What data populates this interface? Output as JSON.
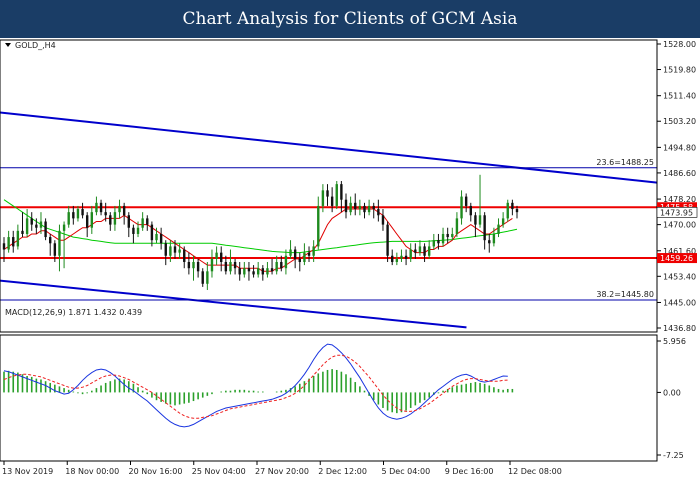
{
  "header": {
    "title": "Chart Analysis for Clients of GCM Asia"
  },
  "colors": {
    "header_bg": "#1a3d66",
    "bull": "#1e8a1e",
    "bear": "#111111",
    "ma_fast": "#e00000",
    "ma_slow": "#00cc00",
    "trend_channel": "#0000cc",
    "sr_line": "#ee0000",
    "fibo_line": "#0000aa",
    "macd_hist": "#2aa02a",
    "macd_line": "#1a35e0",
    "macd_signal": "#ee2020"
  },
  "chart_data": [
    {
      "type": "candlestick",
      "symbol_label": "GOLD_,H4",
      "ylim": [
        1436.8,
        1528.0
      ],
      "y_ticks": [
        "1528.00",
        "1519.80",
        "1511.40",
        "1503.20",
        "1494.80",
        "1486.60",
        "1478.20",
        "1470.00",
        "1461.60",
        "1453.40",
        "1445.00",
        "1436.80"
      ],
      "x_ticks": [
        "13 Nov 2019",
        "18 Nov 00:00",
        "20 Nov 16:00",
        "25 Nov 04:00",
        "27 Nov 20:00",
        "2 Dec 12:00",
        "5 Dec 04:00",
        "9 Dec 16:00",
        "12 Dec 08:00"
      ],
      "levels": [
        {
          "price": 1488.25,
          "label": "23.6=1488.25",
          "kind": "fibo"
        },
        {
          "price": 1475.58,
          "label": "1475.58",
          "kind": "resistance"
        },
        {
          "price": 1459.26,
          "label": "1459.26",
          "kind": "support"
        },
        {
          "price": 1445.8,
          "label": "38.2=1445.80",
          "kind": "fibo"
        }
      ],
      "current_price": {
        "value": 1473.95,
        "label": "1473.95"
      },
      "trend_channel": {
        "upper": {
          "start_price": 1506.0,
          "end_price": 1483.5
        },
        "lower": {
          "start_price": 1452.0,
          "end_price": 1437.0,
          "end_fraction": 0.71
        }
      },
      "candles": [
        [
          1464,
          1462,
          1466,
          1458
        ],
        [
          1462,
          1466,
          1468,
          1461
        ],
        [
          1466,
          1463,
          1468,
          1461
        ],
        [
          1463,
          1468,
          1470,
          1462
        ],
        [
          1468,
          1467,
          1474,
          1466
        ],
        [
          1467,
          1472,
          1475,
          1466
        ],
        [
          1472,
          1470,
          1474,
          1468
        ],
        [
          1470,
          1469,
          1472,
          1467
        ],
        [
          1469,
          1471,
          1474,
          1467
        ],
        [
          1471,
          1466,
          1472,
          1465
        ],
        [
          1466,
          1464,
          1467,
          1460
        ],
        [
          1464,
          1460,
          1465,
          1458
        ],
        [
          1460,
          1468,
          1470,
          1455
        ],
        [
          1468,
          1470,
          1471,
          1456
        ],
        [
          1470,
          1474,
          1476,
          1469
        ],
        [
          1474,
          1472,
          1476,
          1470
        ],
        [
          1472,
          1475,
          1476,
          1471
        ],
        [
          1475,
          1473,
          1477,
          1472
        ],
        [
          1473,
          1469,
          1474,
          1466
        ],
        [
          1469,
          1474,
          1476,
          1467
        ],
        [
          1474,
          1477,
          1479,
          1473
        ],
        [
          1477,
          1474,
          1478,
          1473
        ],
        [
          1474,
          1473,
          1477,
          1471
        ],
        [
          1473,
          1470,
          1474,
          1468
        ],
        [
          1470,
          1474,
          1476,
          1468
        ],
        [
          1474,
          1476,
          1478,
          1472
        ],
        [
          1476,
          1473,
          1477,
          1470
        ],
        [
          1473,
          1469,
          1474,
          1466
        ],
        [
          1469,
          1467,
          1470,
          1464
        ],
        [
          1467,
          1469,
          1471,
          1466
        ],
        [
          1469,
          1472,
          1474,
          1468
        ],
        [
          1472,
          1470,
          1473,
          1468
        ],
        [
          1470,
          1465,
          1471,
          1463
        ],
        [
          1465,
          1467,
          1469,
          1464
        ],
        [
          1467,
          1464,
          1469,
          1462
        ],
        [
          1464,
          1460,
          1465,
          1457
        ],
        [
          1460,
          1463,
          1465,
          1458
        ],
        [
          1463,
          1461,
          1465,
          1459
        ],
        [
          1461,
          1462,
          1464,
          1459
        ],
        [
          1462,
          1458,
          1463,
          1456
        ],
        [
          1458,
          1456,
          1461,
          1454
        ],
        [
          1456,
          1458,
          1460,
          1452
        ],
        [
          1458,
          1455,
          1459,
          1453
        ],
        [
          1455,
          1451,
          1456,
          1450
        ],
        [
          1451,
          1455,
          1458,
          1449
        ],
        [
          1455,
          1459,
          1462,
          1453
        ],
        [
          1459,
          1461,
          1463,
          1457
        ],
        [
          1461,
          1458,
          1463,
          1455
        ],
        [
          1458,
          1455,
          1460,
          1454
        ],
        [
          1455,
          1458,
          1462,
          1454
        ],
        [
          1458,
          1456,
          1459,
          1454
        ],
        [
          1456,
          1454,
          1458,
          1452
        ],
        [
          1454,
          1456,
          1458,
          1453
        ],
        [
          1456,
          1455,
          1458,
          1452
        ],
        [
          1455,
          1454,
          1457,
          1453
        ],
        [
          1454,
          1456,
          1458,
          1453
        ],
        [
          1456,
          1454,
          1457,
          1452
        ],
        [
          1454,
          1456,
          1458,
          1453
        ],
        [
          1456,
          1455,
          1459,
          1454
        ],
        [
          1455,
          1458,
          1460,
          1454
        ],
        [
          1458,
          1456,
          1460,
          1455
        ],
        [
          1456,
          1460,
          1462,
          1454
        ],
        [
          1460,
          1462,
          1465,
          1459
        ],
        [
          1462,
          1459,
          1463,
          1456
        ],
        [
          1459,
          1458,
          1461,
          1455
        ],
        [
          1458,
          1461,
          1464,
          1457
        ],
        [
          1461,
          1460,
          1463,
          1458
        ],
        [
          1460,
          1463,
          1465,
          1458
        ],
        [
          1463,
          1476,
          1479,
          1462
        ],
        [
          1476,
          1481,
          1483,
          1474
        ],
        [
          1481,
          1479,
          1483,
          1476
        ],
        [
          1479,
          1476,
          1482,
          1474
        ],
        [
          1476,
          1483,
          1484,
          1475
        ],
        [
          1483,
          1478,
          1484,
          1474
        ],
        [
          1478,
          1474,
          1480,
          1472
        ],
        [
          1474,
          1477,
          1479,
          1473
        ],
        [
          1477,
          1475,
          1480,
          1473
        ],
        [
          1475,
          1476,
          1478,
          1473
        ],
        [
          1476,
          1474,
          1477,
          1472
        ],
        [
          1474,
          1476,
          1478,
          1473
        ],
        [
          1476,
          1475,
          1477,
          1472
        ],
        [
          1475,
          1473,
          1478,
          1471
        ],
        [
          1473,
          1470,
          1475,
          1468
        ],
        [
          1470,
          1460,
          1471,
          1458
        ],
        [
          1460,
          1458,
          1462,
          1457
        ],
        [
          1458,
          1459,
          1461,
          1457
        ],
        [
          1459,
          1460,
          1462,
          1458
        ],
        [
          1460,
          1459,
          1462,
          1457
        ],
        [
          1459,
          1462,
          1464,
          1458
        ],
        [
          1462,
          1461,
          1464,
          1459
        ],
        [
          1461,
          1463,
          1465,
          1460
        ],
        [
          1463,
          1460,
          1464,
          1458
        ],
        [
          1460,
          1463,
          1465,
          1459
        ],
        [
          1463,
          1465,
          1467,
          1462
        ],
        [
          1465,
          1464,
          1467,
          1462
        ],
        [
          1464,
          1467,
          1469,
          1463
        ],
        [
          1467,
          1466,
          1469,
          1464
        ],
        [
          1466,
          1467,
          1469,
          1465
        ],
        [
          1467,
          1472,
          1474,
          1466
        ],
        [
          1472,
          1479,
          1481,
          1470
        ],
        [
          1479,
          1476,
          1480,
          1474
        ],
        [
          1476,
          1473,
          1477,
          1471
        ],
        [
          1473,
          1470,
          1474,
          1466
        ],
        [
          1470,
          1473,
          1486,
          1469
        ],
        [
          1473,
          1465,
          1474,
          1462
        ],
        [
          1465,
          1464,
          1467,
          1461
        ],
        [
          1464,
          1467,
          1469,
          1463
        ],
        [
          1467,
          1470,
          1472,
          1466
        ],
        [
          1470,
          1472,
          1474,
          1469
        ],
        [
          1472,
          1477,
          1478,
          1471
        ],
        [
          1477,
          1475,
          1478,
          1473
        ],
        [
          1475,
          1474,
          1476,
          1472
        ]
      ],
      "ma_fast": [
        1462,
        1463,
        1464,
        1465,
        1466,
        1466,
        1467,
        1467,
        1468,
        1468,
        1467,
        1466,
        1465,
        1465,
        1466,
        1467,
        1468,
        1469,
        1469,
        1470,
        1471,
        1471,
        1472,
        1472,
        1472,
        1472,
        1473,
        1472,
        1471,
        1470,
        1470,
        1470,
        1469,
        1468,
        1467,
        1466,
        1465,
        1464,
        1463,
        1462,
        1461,
        1460,
        1459,
        1458,
        1457,
        1457,
        1457,
        1457,
        1457,
        1457,
        1457,
        1456,
        1456,
        1456,
        1456,
        1456,
        1455,
        1455,
        1455,
        1456,
        1456,
        1457,
        1458,
        1459,
        1459,
        1460,
        1461,
        1462,
        1464,
        1467,
        1470,
        1472,
        1473,
        1474,
        1475,
        1475,
        1475,
        1475,
        1475,
        1475,
        1475,
        1474,
        1473,
        1471,
        1469,
        1467,
        1465,
        1463,
        1462,
        1461,
        1461,
        1461,
        1462,
        1462,
        1463,
        1463,
        1464,
        1465,
        1467,
        1468,
        1469,
        1470,
        1469,
        1468,
        1467,
        1467,
        1468,
        1469,
        1470,
        1471,
        1472
      ],
      "ma_slow": [
        1478,
        1477,
        1476,
        1475,
        1474,
        1473,
        1472,
        1471,
        1470,
        1469,
        1468.5,
        1468,
        1467.5,
        1467,
        1466.5,
        1466,
        1465.8,
        1465.5,
        1465.3,
        1465,
        1464.8,
        1464.6,
        1464.4,
        1464.2,
        1464,
        1464,
        1464,
        1464,
        1464,
        1464,
        1464,
        1464,
        1464,
        1464,
        1464,
        1464,
        1464,
        1464,
        1464,
        1464,
        1464,
        1464,
        1464,
        1464,
        1464,
        1464,
        1463.8,
        1463.6,
        1463.4,
        1463.2,
        1463,
        1462.8,
        1462.6,
        1462.4,
        1462.2,
        1462,
        1461.8,
        1461.6,
        1461.4,
        1461.3,
        1461.2,
        1461.1,
        1461,
        1461,
        1461,
        1461.2,
        1461.4,
        1461.6,
        1461.8,
        1462,
        1462.2,
        1462.4,
        1462.6,
        1462.8,
        1463,
        1463.2,
        1463.4,
        1463.6,
        1463.8,
        1464,
        1464.2,
        1464.3,
        1464.4,
        1464.5,
        1464.6,
        1464.6,
        1464.6,
        1464.6,
        1464.6,
        1464.6,
        1464.6,
        1464.6,
        1464.7,
        1464.8,
        1464.9,
        1465,
        1465.1,
        1465.2,
        1465.4,
        1465.6,
        1465.8,
        1466,
        1466.2,
        1466.4,
        1466.6,
        1466.8,
        1467,
        1467.3,
        1467.6,
        1467.9,
        1468.2,
        1468.5
      ]
    },
    {
      "type": "macd",
      "label": "MACD(12,26,9) 1.871 1.432 0.439",
      "params": "12,26,9",
      "values_at_last_bar": {
        "macd": 1.871,
        "signal": 1.432,
        "histogram": 0.439
      },
      "ylim": [
        -7.25,
        5.956
      ],
      "y_ticks": [
        "5.956",
        "0.00",
        "-7.25"
      ],
      "histogram": [
        2.4,
        2.5,
        2.4,
        2.3,
        2.1,
        1.9,
        1.8,
        1.6,
        1.5,
        1.3,
        1.1,
        0.9,
        0.7,
        0.5,
        0.3,
        0.1,
        -0.1,
        -0.2,
        -0.1,
        0.2,
        0.5,
        0.8,
        1.1,
        1.3,
        1.5,
        1.6,
        1.5,
        1.3,
        1.0,
        0.6,
        0.2,
        -0.2,
        -0.6,
        -0.9,
        -1.1,
        -1.3,
        -1.4,
        -1.5,
        -1.4,
        -1.3,
        -1.2,
        -1.0,
        -0.8,
        -0.6,
        -0.4,
        -0.2,
        0.0,
        0.1,
        0.2,
        0.2,
        0.3,
        0.3,
        0.3,
        0.2,
        0.2,
        0.1,
        0.1,
        0.0,
        0.0,
        0.1,
        0.2,
        0.3,
        0.5,
        0.7,
        1.0,
        1.3,
        1.6,
        1.9,
        2.2,
        2.4,
        2.6,
        2.7,
        2.6,
        2.4,
        2.1,
        1.7,
        1.2,
        0.7,
        0.2,
        -0.4,
        -0.9,
        -1.4,
        -1.8,
        -2.1,
        -2.3,
        -2.4,
        -2.3,
        -2.1,
        -1.8,
        -1.5,
        -1.2,
        -0.9,
        -0.6,
        -0.3,
        -0.1,
        0.2,
        0.4,
        0.6,
        0.8,
        0.9,
        1.0,
        1.1,
        1.2,
        1.1,
        1.0,
        0.8,
        0.6,
        0.4,
        0.3,
        0.4,
        0.4
      ],
      "macd": [
        2.5,
        2.4,
        2.2,
        2.0,
        1.8,
        1.6,
        1.4,
        1.2,
        1.0,
        0.8,
        0.5,
        0.2,
        0.0,
        -0.2,
        -0.1,
        0.3,
        0.8,
        1.4,
        1.9,
        2.3,
        2.6,
        2.7,
        2.6,
        2.3,
        1.9,
        1.4,
        0.9,
        0.5,
        0.2,
        -0.2,
        -0.6,
        -1.0,
        -1.5,
        -2.0,
        -2.5,
        -3.0,
        -3.4,
        -3.7,
        -3.9,
        -4.0,
        -3.9,
        -3.7,
        -3.4,
        -3.1,
        -2.8,
        -2.5,
        -2.2,
        -2.0,
        -1.8,
        -1.7,
        -1.6,
        -1.5,
        -1.4,
        -1.3,
        -1.2,
        -1.1,
        -1.0,
        -0.9,
        -0.8,
        -0.6,
        -0.4,
        -0.1,
        0.3,
        0.8,
        1.4,
        2.1,
        2.9,
        3.8,
        4.6,
        5.2,
        5.6,
        5.5,
        5.1,
        4.6,
        4.0,
        3.3,
        2.5,
        1.7,
        0.8,
        -0.1,
        -1.0,
        -1.8,
        -2.4,
        -2.8,
        -3.0,
        -3.1,
        -3.0,
        -2.8,
        -2.5,
        -2.1,
        -1.7,
        -1.2,
        -0.7,
        -0.2,
        0.3,
        0.7,
        1.1,
        1.5,
        1.8,
        2.0,
        2.1,
        1.9,
        1.6,
        1.3,
        1.2,
        1.3,
        1.5,
        1.7,
        1.9,
        1.87
      ],
      "signal": [
        1.5,
        1.7,
        1.9,
        2.0,
        2.1,
        2.1,
        2.0,
        1.9,
        1.8,
        1.6,
        1.4,
        1.2,
        1.0,
        0.8,
        0.6,
        0.5,
        0.5,
        0.6,
        0.8,
        1.1,
        1.4,
        1.7,
        1.9,
        2.0,
        2.0,
        1.9,
        1.7,
        1.5,
        1.2,
        0.9,
        0.6,
        0.3,
        0.0,
        -0.4,
        -0.8,
        -1.2,
        -1.6,
        -2.0,
        -2.4,
        -2.7,
        -2.9,
        -3.0,
        -3.0,
        -2.9,
        -2.8,
        -2.7,
        -2.5,
        -2.3,
        -2.1,
        -1.9,
        -1.8,
        -1.7,
        -1.6,
        -1.5,
        -1.4,
        -1.3,
        -1.2,
        -1.1,
        -1.0,
        -0.9,
        -0.8,
        -0.6,
        -0.4,
        -0.1,
        0.3,
        0.8,
        1.4,
        2.0,
        2.6,
        3.2,
        3.7,
        4.1,
        4.3,
        4.3,
        4.2,
        3.9,
        3.5,
        3.0,
        2.4,
        1.8,
        1.1,
        0.4,
        -0.3,
        -0.9,
        -1.4,
        -1.8,
        -2.1,
        -2.2,
        -2.2,
        -2.1,
        -1.9,
        -1.6,
        -1.3,
        -0.9,
        -0.5,
        -0.1,
        0.3,
        0.7,
        1.0,
        1.3,
        1.5,
        1.6,
        1.6,
        1.5,
        1.4,
        1.3,
        1.3,
        1.3,
        1.4,
        1.43
      ]
    }
  ]
}
